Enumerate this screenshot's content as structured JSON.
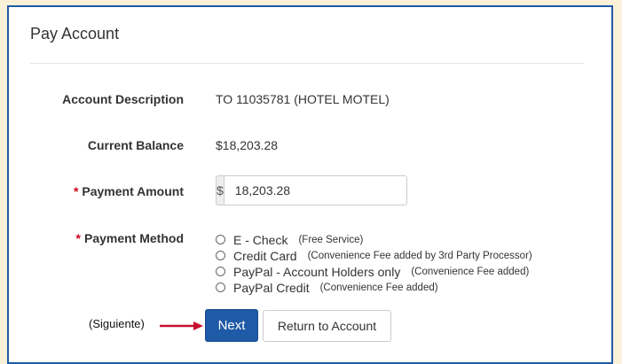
{
  "panel": {
    "title": "Pay Account"
  },
  "form": {
    "account_description": {
      "label": "Account Description",
      "value": "TO 11035781 (HOTEL MOTEL)"
    },
    "current_balance": {
      "label": "Current Balance",
      "value": "$18,203.28"
    },
    "payment_amount": {
      "required_mark": "*",
      "label": "Payment Amount",
      "currency_symbol": "$",
      "value": "18,203.28"
    },
    "payment_method": {
      "required_mark": "*",
      "label": "Payment Method",
      "options": [
        {
          "label": "E - Check",
          "note": "(Free Service)"
        },
        {
          "label": "Credit Card",
          "note": "(Convenience Fee added by 3rd Party Processor)"
        },
        {
          "label": "PayPal - Account Holders only",
          "note": "(Convenience Fee added)"
        },
        {
          "label": "PayPal Credit",
          "note": "(Convenience Fee added)"
        }
      ]
    }
  },
  "annotation": {
    "text": "(Siguiente)",
    "arrow_color": "#c8102e"
  },
  "buttons": {
    "next": "Next",
    "return": "Return to Account"
  },
  "colors": {
    "accent": "#1f5aa6",
    "required": "#d0021b",
    "page_bg": "#fbf1d9"
  }
}
